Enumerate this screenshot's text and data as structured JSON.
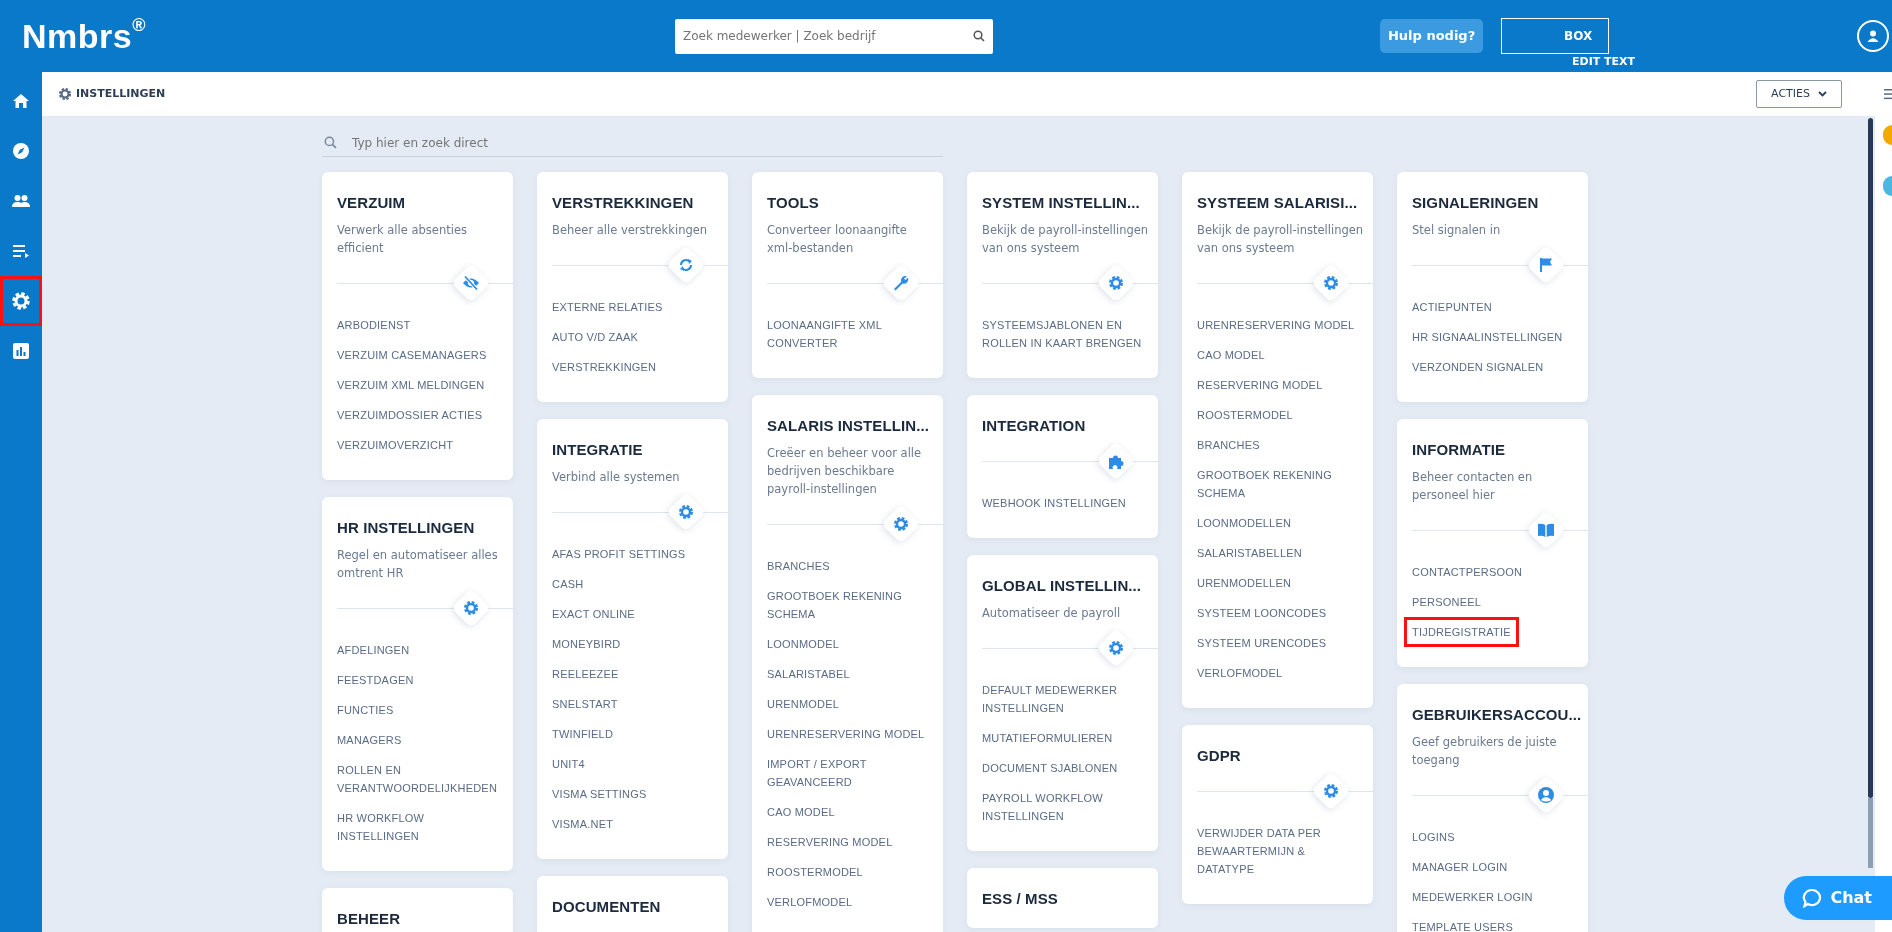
{
  "topbar": {
    "logo": "Nmbrs",
    "logo_mark": "®",
    "search": {
      "placeholder": "Zoek medewerker | Zoek bedrijf"
    },
    "help_button": "Hulp nodig?",
    "sandbox_button": "BOX",
    "overlay_text": "EDIT TEXT"
  },
  "sidebar": {
    "items": [
      {
        "kind": "home",
        "highlighted": false
      },
      {
        "kind": "compass",
        "highlighted": false
      },
      {
        "kind": "people",
        "highlighted": false
      },
      {
        "kind": "list",
        "highlighted": false
      },
      {
        "kind": "gear",
        "highlighted": true
      },
      {
        "kind": "chart",
        "highlighted": false
      }
    ]
  },
  "subheader": {
    "title": "INSTELLINGEN",
    "actions_button": "ACTIES"
  },
  "search": {
    "placeholder": "Typ hier en zoek direct"
  },
  "columns": [
    {
      "cards": [
        {
          "title": "VERZUIM",
          "description": "Verwerk alle absenties efficient",
          "kind": "eye-off",
          "items": [
            {
              "label": "ARBODIENST",
              "highlighted": false
            },
            {
              "label": "VERZUIM CASEMANAGERS",
              "highlighted": false
            },
            {
              "label": "VERZUIM XML MELDINGEN",
              "highlighted": false
            },
            {
              "label": "VERZUIMDOSSIER ACTIES",
              "highlighted": false
            },
            {
              "label": "VERZUIMOVERZICHT",
              "highlighted": false
            }
          ]
        },
        {
          "title": "HR INSTELLINGEN",
          "description": "Regel en automatiseer alles omtrent HR",
          "kind": "gear",
          "items": [
            {
              "label": "AFDELINGEN",
              "highlighted": false
            },
            {
              "label": "FEESTDAGEN",
              "highlighted": false
            },
            {
              "label": "FUNCTIES",
              "highlighted": false
            },
            {
              "label": "MANAGERS",
              "highlighted": false
            },
            {
              "label": "ROLLEN EN VERANTWOORDELIJKHEDEN",
              "highlighted": false
            },
            {
              "label": "HR WORKFLOW INSTELLINGEN",
              "highlighted": false
            }
          ]
        },
        {
          "title": "BEHEER"
        }
      ]
    },
    {
      "cards": [
        {
          "title": "VERSTREKKINGEN",
          "description": "Beheer alle verstrekkingen",
          "kind": "sync",
          "items": [
            {
              "label": "EXTERNE RELATIES",
              "highlighted": false
            },
            {
              "label": "AUTO V/D ZAAK",
              "highlighted": false
            },
            {
              "label": "VERSTREKKINGEN",
              "highlighted": false
            }
          ]
        },
        {
          "title": "INTEGRATIE",
          "description": "Verbind alle systemen",
          "kind": "gear",
          "items": [
            {
              "label": "AFAS PROFIT SETTINGS",
              "highlighted": false
            },
            {
              "label": "CASH",
              "highlighted": false
            },
            {
              "label": "EXACT ONLINE",
              "highlighted": false
            },
            {
              "label": "MONEYBIRD",
              "highlighted": false
            },
            {
              "label": "REELEEZEE",
              "highlighted": false
            },
            {
              "label": "SNELSTART",
              "highlighted": false
            },
            {
              "label": "TWINFIELD",
              "highlighted": false
            },
            {
              "label": "UNIT4",
              "highlighted": false
            },
            {
              "label": "VISMA SETTINGS",
              "highlighted": false
            },
            {
              "label": "VISMA.NET",
              "highlighted": false
            }
          ]
        },
        {
          "title": "DOCUMENTEN"
        }
      ]
    },
    {
      "cards": [
        {
          "title": "TOOLS",
          "description": "Converteer loonaangifte xml-bestanden",
          "kind": "wrench",
          "items": [
            {
              "label": "LOONAANGIFTE XML CONVERTER",
              "highlighted": false
            }
          ]
        },
        {
          "title": "SALARIS INSTELLIN...",
          "description": "Creëer en beheer voor alle bedrijven beschikbare payroll-instellingen",
          "kind": "gear",
          "items": [
            {
              "label": "BRANCHES",
              "highlighted": false
            },
            {
              "label": "GROOTBOEK REKENING SCHEMA",
              "highlighted": false
            },
            {
              "label": "LOONMODEL",
              "highlighted": false
            },
            {
              "label": "SALARISTABEL",
              "highlighted": false
            },
            {
              "label": "URENMODEL",
              "highlighted": false
            },
            {
              "label": "URENRESERVERING MODEL",
              "highlighted": false
            },
            {
              "label": "IMPORT / EXPORT GEAVANCEERD",
              "highlighted": false
            },
            {
              "label": "CAO MODEL",
              "highlighted": false
            },
            {
              "label": "RESERVERING MODEL",
              "highlighted": false
            },
            {
              "label": "ROOSTERMODEL",
              "highlighted": false
            },
            {
              "label": "VERLOFMODEL",
              "highlighted": false
            }
          ]
        }
      ]
    },
    {
      "cards": [
        {
          "title": "SYSTEM INSTELLIN...",
          "description": "Bekijk de payroll-instellingen van ons systeem",
          "kind": "gear",
          "items": [
            {
              "label": "SYSTEEMSJABLONEN EN ROLLEN IN KAART BRENGEN",
              "highlighted": false
            }
          ]
        },
        {
          "title": "INTEGRATION",
          "kind": "puzzle",
          "items": [
            {
              "label": "WEBHOOK INSTELLINGEN",
              "highlighted": false
            }
          ]
        },
        {
          "title": "GLOBAL INSTELLIN...",
          "description": "Automatiseer de payroll",
          "kind": "gear",
          "items": [
            {
              "label": "DEFAULT MEDEWERKER INSTELLINGEN",
              "highlighted": false
            },
            {
              "label": "MUTATIEFORMULIEREN",
              "highlighted": false
            },
            {
              "label": "DOCUMENT SJABLONEN",
              "highlighted": false
            },
            {
              "label": "PAYROLL WORKFLOW INSTELLINGEN",
              "highlighted": false
            }
          ]
        },
        {
          "title": "ESS / MSS"
        }
      ]
    },
    {
      "cards": [
        {
          "title": "SYSTEEM SALARISI...",
          "description": "Bekijk de payroll-instellingen van ons systeem",
          "kind": "gear",
          "items": [
            {
              "label": "URENRESERVERING MODEL",
              "highlighted": false
            },
            {
              "label": "CAO MODEL",
              "highlighted": false
            },
            {
              "label": "RESERVERING MODEL",
              "highlighted": false
            },
            {
              "label": "ROOSTERMODEL",
              "highlighted": false
            },
            {
              "label": "BRANCHES",
              "highlighted": false
            },
            {
              "label": "GROOTBOEK REKENING SCHEMA",
              "highlighted": false
            },
            {
              "label": "LOONMODELLEN",
              "highlighted": false
            },
            {
              "label": "SALARISTABELLEN",
              "highlighted": false
            },
            {
              "label": "URENMODELLEN",
              "highlighted": false
            },
            {
              "label": "SYSTEEM LOONCODES",
              "highlighted": false
            },
            {
              "label": "SYSTEEM URENCODES",
              "highlighted": false
            },
            {
              "label": "VERLOFMODEL",
              "highlighted": false
            }
          ]
        },
        {
          "title": "GDPR",
          "kind": "gear",
          "items": [
            {
              "label": "VERWIJDER DATA PER BEWAARTERMIJN & DATATYPE",
              "highlighted": false
            }
          ]
        }
      ]
    },
    {
      "cards": [
        {
          "title": "SIGNALERINGEN",
          "description": "Stel signalen in",
          "kind": "flag",
          "items": [
            {
              "label": "ACTIEPUNTEN",
              "highlighted": false
            },
            {
              "label": "HR SIGNAALINSTELLINGEN",
              "highlighted": false
            },
            {
              "label": "VERZONDEN SIGNALEN",
              "highlighted": false
            }
          ]
        },
        {
          "title": "INFORMATIE",
          "description": "Beheer contacten en personeel hier",
          "kind": "book",
          "items": [
            {
              "label": "CONTACTPERSOON",
              "highlighted": false
            },
            {
              "label": "PERSONEEL",
              "highlighted": false
            },
            {
              "label": "TIJDREGISTRATIE",
              "highlighted": true
            }
          ]
        },
        {
          "title": "GEBRUIKERSACCOU...",
          "description": "Geef gebruikers de juiste toegang",
          "kind": "user",
          "items": [
            {
              "label": "LOGINS",
              "highlighted": false
            },
            {
              "label": "MANAGER LOGIN",
              "highlighted": false
            },
            {
              "label": "MEDEWERKER LOGIN",
              "highlighted": false
            },
            {
              "label": "TEMPLATE USERS",
              "highlighted": false
            }
          ]
        }
      ]
    }
  ],
  "chat_button": "Chat"
}
